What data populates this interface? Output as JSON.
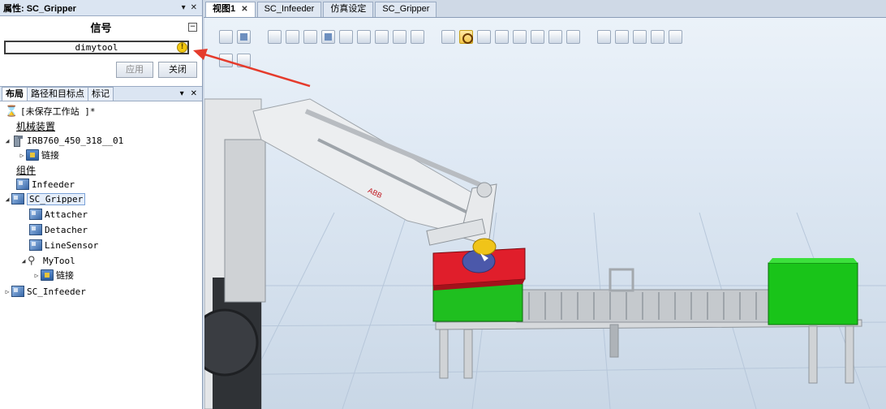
{
  "properties_panel": {
    "title": "属性: SC_Gripper",
    "pin_glyph": "▾",
    "close_glyph": "✕",
    "section_title": "信号",
    "collapse_glyph": "−",
    "signal_value": "dimytool",
    "warning_glyph": "!",
    "apply_label": "应用",
    "close_label": "关闭"
  },
  "layout_panel": {
    "tabs": [
      {
        "label": "布局",
        "active": true
      },
      {
        "label": "路径和目标点",
        "active": false
      },
      {
        "label": "标记",
        "active": false
      }
    ],
    "pin_glyph": "▾",
    "close_glyph": "✕",
    "station": "[未保存工作站 ]*",
    "sections": {
      "mechanisms": "机械装置",
      "components": "组件"
    },
    "robot": "IRB760_450_318__01",
    "robot_link": "链接",
    "components": [
      "Infeeder",
      "SC_Gripper",
      "Attacher",
      "Detacher",
      "LineSensor",
      "MyTool",
      "SC_Infeeder"
    ],
    "mytool_link": "链接"
  },
  "doc_tabs": [
    {
      "label": "视图1",
      "active": true
    },
    {
      "label": "SC_Infeeder",
      "active": false
    },
    {
      "label": "仿真设定",
      "active": false
    },
    {
      "label": "SC_Gripper",
      "active": false
    }
  ],
  "tab_close_glyph": "✕",
  "scene": {
    "robot_logo": "ABB"
  },
  "colors": {
    "annotation_arrow": "#e53b2c",
    "red_box": "#e01e2b",
    "green_box": "#1fc21f",
    "robot": "#e6e8ea"
  }
}
